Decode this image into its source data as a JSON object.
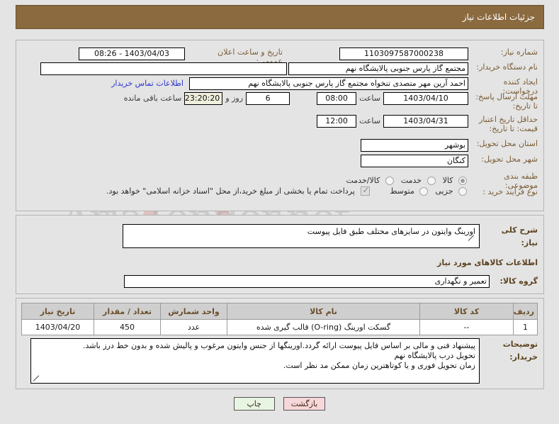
{
  "header": {
    "title": "جزئیات اطلاعات نیاز"
  },
  "watermark": {
    "text": "AriaTender.net"
  },
  "main": {
    "need_number": {
      "label": "شماره نیاز:",
      "value": "1103097587000238"
    },
    "announce_datetime": {
      "label": "تاریخ و ساعت اعلان عمومی:",
      "value": "1403/04/03 - 08:26"
    },
    "buyer_org": {
      "label": "نام دستگاه خریدار:",
      "value": "مجتمع گاز پارس جنوبی  پالایشگاه نهم"
    },
    "buyer_org_extra": {
      "value": ""
    },
    "requester": {
      "label": "ایجاد کننده درخواست:",
      "value": "احمد آرین مهر متصدی تنخواه مجتمع گاز پارس جنوبی  پالایشگاه نهم"
    },
    "contact_link": {
      "label": "اطلاعات تماس خریدار"
    },
    "response_deadline": {
      "label": "مهلت ارسال پاسخ: تا تاریخ:",
      "date": "1403/04/10",
      "time_label": "ساعت",
      "time": "08:00",
      "days": "6",
      "days_label": "روز و",
      "countdown": "23:20:20",
      "remaining_label": "ساعت باقی مانده"
    },
    "price_validity": {
      "label": "حداقل تاریخ اعتبار قیمت: تا تاریخ:",
      "date": "1403/04/31",
      "time_label": "ساعت",
      "time": "12:00"
    },
    "province": {
      "label": "استان محل تحویل:",
      "value": "بوشهر"
    },
    "city": {
      "label": "شهر محل تحویل:",
      "value": "کنگان"
    },
    "subject_class": {
      "label": "طبقه بندی موضوعی:",
      "options": [
        {
          "label": "کالا",
          "selected": true
        },
        {
          "label": "خدمت",
          "selected": false
        },
        {
          "label": "کالا/خدمت",
          "selected": false
        }
      ]
    },
    "purchase_type": {
      "label": "نوع فرآیند خرید :",
      "options": [
        {
          "label": "جزیی",
          "selected": false
        },
        {
          "label": "متوسط",
          "selected": false
        }
      ]
    },
    "treasury_note": {
      "checked": true,
      "text": "پرداخت تمام یا بخشی از مبلغ خرید،از محل \"اسناد خزانه اسلامی\" خواهد بود."
    }
  },
  "description": {
    "label": "شرح کلی نیاز:",
    "value": "اورینگ وایتون در سایزهای مختلف طبق فایل پیوست"
  },
  "items_section": {
    "title": "اطلاعات کالاهای مورد نیاز",
    "group": {
      "label": "گروه کالا:",
      "value": "تعمیر و نگهداری"
    },
    "table": {
      "columns": [
        "ردیف",
        "کد کالا",
        "نام کالا",
        "واحد شمارش",
        "تعداد / مقدار",
        "تاریخ نیاز"
      ],
      "rows": [
        [
          "1",
          "--",
          "گسکت اورینگ (O-ring) قالب گیری شده",
          "عدد",
          "450",
          "1403/04/20"
        ]
      ]
    },
    "buyer_notes": {
      "label": "توضیحات خریدار:",
      "line1": "پیشنهاد فنی و مالی بر اساس فایل پیوست ارائه گردد.اورینگها از جنس وایتون مرغوب و پالیش شده و بدون خط درز باشد.",
      "line2": "تحویل درب پالایشگاه نهم",
      "line3": "زمان تحویل فوری و یا کوتاهترین زمان ممکن مد نظر است."
    }
  },
  "footer": {
    "print_label": "چاپ",
    "back_label": "بازگشت"
  }
}
